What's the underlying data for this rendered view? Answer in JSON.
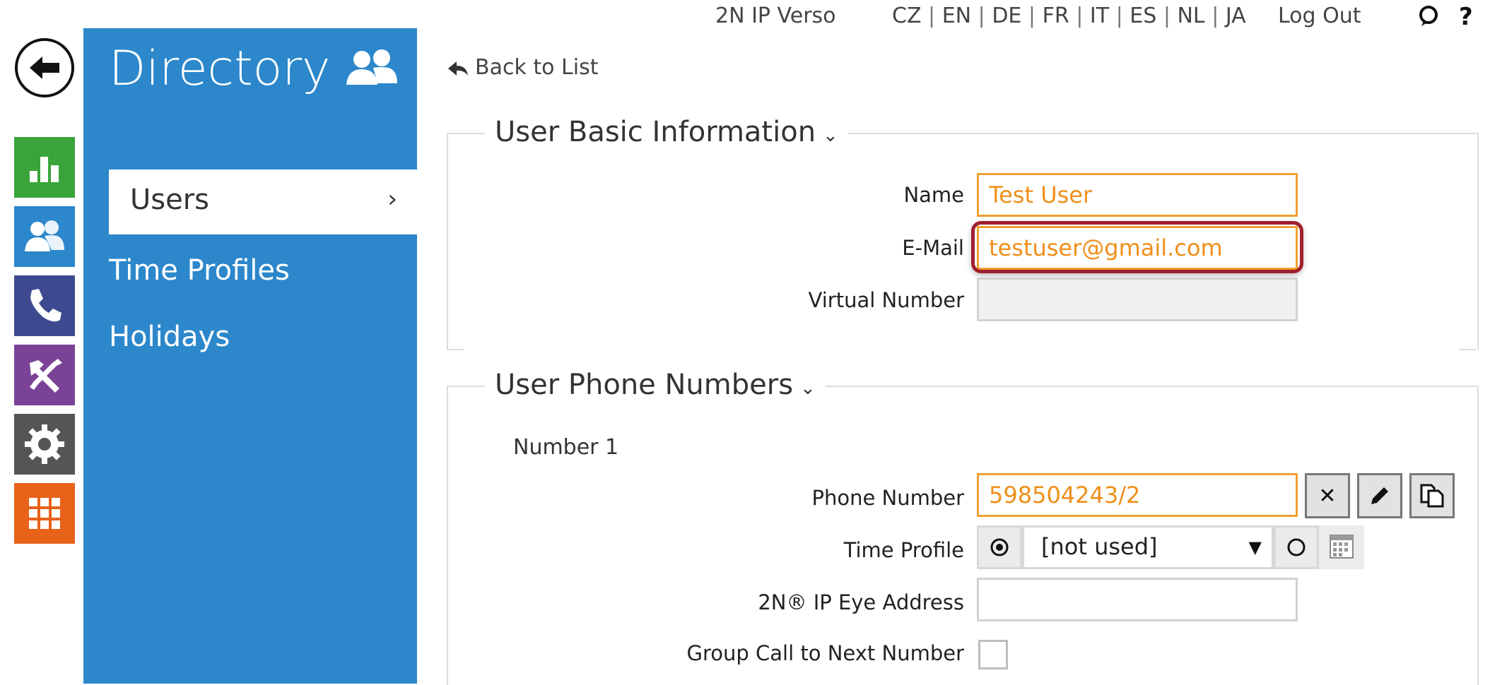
{
  "topbar": {
    "device": "2N IP Verso",
    "languages": [
      "CZ",
      "EN",
      "DE",
      "FR",
      "IT",
      "ES",
      "NL",
      "JA"
    ],
    "logout": "Log Out",
    "icons": [
      "back-arrow-icon",
      "chat-icon",
      "help-icon"
    ],
    "help": "?"
  },
  "rail": {
    "items": [
      {
        "name": "status-icon",
        "color": "#3aa43b"
      },
      {
        "name": "directory-icon",
        "color": "#2c87cb"
      },
      {
        "name": "calls-icon",
        "color": "#3d4a8f"
      },
      {
        "name": "hardware-icon",
        "color": "#7a4397"
      },
      {
        "name": "services-icon",
        "color": "#555555"
      },
      {
        "name": "system-icon",
        "color": "#e8621a"
      }
    ]
  },
  "panel": {
    "title": "Directory",
    "icon": "users-icon",
    "menu": [
      {
        "label": "Users",
        "active": true,
        "arrow": "›"
      },
      {
        "label": "Time Profiles",
        "active": false
      },
      {
        "label": "Holidays",
        "active": false
      }
    ]
  },
  "main": {
    "back_link": "Back to List",
    "basic": {
      "title": "User Basic Information",
      "name_label": "Name",
      "name_value": "Test User",
      "email_label": "E-Mail",
      "email_value": "testuser@gmail.com",
      "virtual_label": "Virtual Number",
      "virtual_value": ""
    },
    "phones": {
      "title": "User Phone Numbers",
      "number_heading": "Number 1",
      "phone_label": "Phone Number",
      "phone_value": "598504243/2",
      "time_profile_label": "Time Profile",
      "time_profile_value": "[not used]",
      "ip_eye_label": "2N® IP Eye Address",
      "ip_eye_value": "",
      "group_call_label": "Group Call to Next Number",
      "group_call_checked": false,
      "buttons": [
        "clear-icon",
        "edit-icon",
        "copy-icon"
      ],
      "clear_glyph": "✕"
    }
  },
  "colors": {
    "panel_blue": "#2c87cb",
    "accent_orange": "#ef8f1a",
    "highlight_red": "#a01e2e"
  }
}
